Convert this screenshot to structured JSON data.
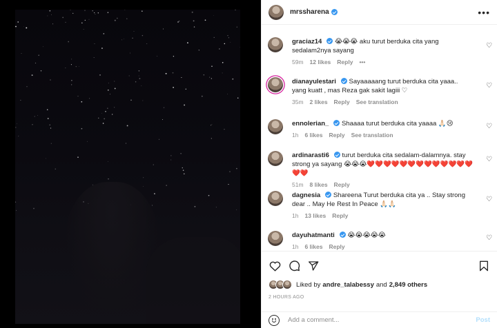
{
  "post": {
    "owner": "mrssharena",
    "more_label": "•••"
  },
  "comments": [
    {
      "user": "graciaz14",
      "verified": true,
      "text": "aku turut berduka cita yang sedalam2nya sayang",
      "emojis_prefix": "😭😭😭",
      "time": "59m",
      "likes": "12 likes",
      "reply": "Reply",
      "extra": "•••"
    },
    {
      "user": "dianayulestari",
      "verified": true,
      "text": "Sayaaaaang turut berduka cita yaaa.. yang kuatt , mas Reza gak sakit lagiii ♡",
      "time": "35m",
      "likes": "2 likes",
      "reply": "Reply",
      "extra": "See translation"
    },
    {
      "user": "ennolerian_",
      "verified": true,
      "text": "Shaaaa turut berduka cita yaaaa 🙏🏻😢",
      "time": "1h",
      "likes": "6 likes",
      "reply": "Reply",
      "extra": "See translation"
    },
    {
      "user": "ardinarasti6",
      "verified": true,
      "text": "turut berduka cita sedalam-dalamnya. stay strong ya sayang 😭😭😭❤️❤️❤️❤️❤️❤️❤️❤️❤️❤️❤️❤️❤️❤️❤️",
      "time": "51m",
      "likes": "8 likes",
      "reply": "Reply"
    },
    {
      "user": "dagnesia",
      "verified": true,
      "text": "Shareena Turut berduka cita ya .. Stay strong dear .. May He Rest In Peace 🙏🏻🙏🏻",
      "time": "1h",
      "likes": "13 likes",
      "reply": "Reply"
    },
    {
      "user": "dayuhatmanti",
      "verified": true,
      "text": "😭😭😭😭😭",
      "time": "1h",
      "likes": "6 likes",
      "reply": "Reply"
    }
  ],
  "likes": {
    "prefix": "Liked by",
    "user": "andre_talabessy",
    "mid": "and",
    "others": "2,849 others"
  },
  "post_time": "2 HOURS AGO",
  "comment_box": {
    "placeholder": "Add a comment...",
    "post_label": "Post"
  },
  "colors": {
    "verified": "#3897f0",
    "post_disabled": "#b2dffc",
    "heart": "#e0245e"
  }
}
